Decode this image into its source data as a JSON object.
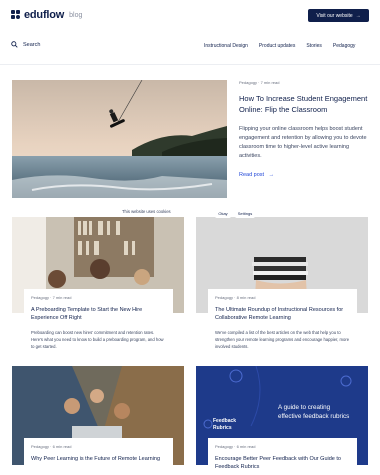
{
  "header": {
    "brand": "eduflow",
    "section": "blog",
    "visit_button": "Visit our website",
    "visit_arrow": "→"
  },
  "nav": {
    "search_label": "Search",
    "items": [
      "Instructional Design",
      "Product updates",
      "Stories",
      "Pedagogy"
    ]
  },
  "featured": {
    "meta": "Pedagogy · 7 min read",
    "title": "How To Increase Student Engagement Online: Flip the Classroom",
    "excerpt": "Flipping your online classroom helps boost student engagement and retention by allowing you to devote classroom time to higher-level active learning activities.",
    "read_more": "Read post",
    "read_more_arrow": "→"
  },
  "cookie": {
    "text": "This website uses cookies",
    "okay": "Okay",
    "settings": "Settings"
  },
  "cards": [
    {
      "meta": "Pedagogy · 7 min read",
      "title": "A Preboarding Template to Start the New Hire Experience Off Right",
      "excerpt": "Preboarding can boost new hires' commitment and retention rates. Here's what you need to know to build a preboarding program, and how to get started."
    },
    {
      "meta": "Pedagogy · 8 min read",
      "title": "The Ultimate Roundup of Instructional Resources for Collaborative Remote Learning",
      "excerpt": "We've compiled a list of the best articles on the web that help you to strengthen your remote learning programs and encourage happier, more involved students."
    },
    {
      "meta": "Pedagogy · 6 min read",
      "title": "Why Peer Learning is the Future of Remote Learning",
      "excerpt": ""
    },
    {
      "meta": "Pedagogy · 6 min read",
      "title": "Encourage Better Peer Feedback with Our Guide to Feedback Rubrics",
      "excerpt": "",
      "image_badge": "Feedback Rubrics",
      "image_caption": "A guide to creating effective feedback rubrics"
    }
  ],
  "colors": {
    "navy": "#0f1f4b",
    "accent": "#2147d8",
    "rubric_blue": "#1e3a8a"
  }
}
